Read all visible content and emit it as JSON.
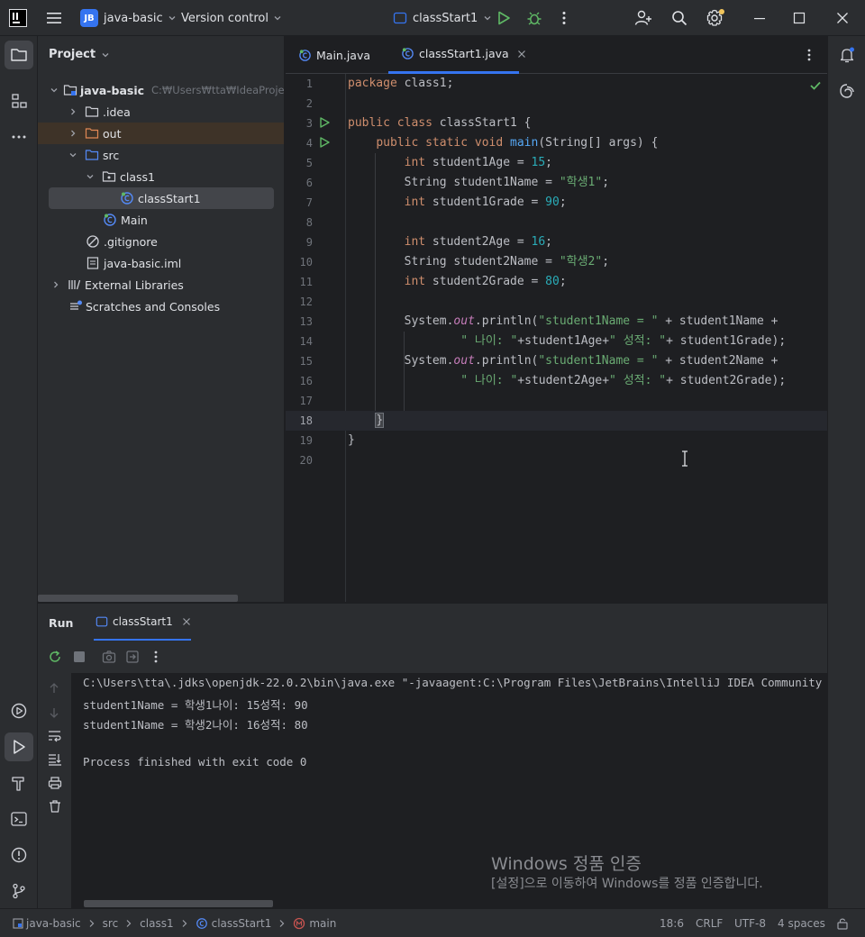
{
  "titlebar": {
    "project_badge": "JB",
    "project_name": "java-basic",
    "vcs_label": "Version control",
    "run_config": "classStart1"
  },
  "project_panel": {
    "title": "Project",
    "root_name": "java-basic",
    "root_path": "C:₩Users₩tta₩IdeaProjects₩java-basic",
    "items": [
      {
        "label": ".idea"
      },
      {
        "label": "out"
      },
      {
        "label": "src"
      },
      {
        "label": "class1"
      },
      {
        "label": "classStart1"
      },
      {
        "label": "Main"
      },
      {
        "label": ".gitignore"
      },
      {
        "label": "java-basic.iml"
      },
      {
        "label": "External Libraries"
      },
      {
        "label": "Scratches and Consoles"
      }
    ]
  },
  "editor": {
    "tabs": [
      {
        "label": "Main.java"
      },
      {
        "label": "classStart1.java"
      }
    ],
    "line_numbers": [
      "1",
      "2",
      "3",
      "4",
      "5",
      "6",
      "7",
      "8",
      "9",
      "10",
      "11",
      "12",
      "13",
      "14",
      "15",
      "16",
      "17",
      "18",
      "19",
      "20"
    ],
    "current_line": 18,
    "code": {
      "l1_kw": "package",
      "l1_rest": " class1;",
      "l3_kw": "public class",
      "l3_rest": " classStart1 {",
      "l4_kw": "public static void",
      "l4_fn": "main",
      "l4_rest": "(String[] args) {",
      "l5_kw": "int",
      "l5_a": " student1Age = ",
      "l5_num": "15",
      "l5_b": ";",
      "l6_a": "String student1Name = ",
      "l6_str": "\"학생1\"",
      "l6_b": ";",
      "l7_kw": "int",
      "l7_a": " student1Grade = ",
      "l7_num": "90",
      "l7_b": ";",
      "l9_kw": "int",
      "l9_a": " student2Age = ",
      "l9_num": "16",
      "l9_b": ";",
      "l10_a": "String student2Name = ",
      "l10_str": "\"학생2\"",
      "l10_b": ";",
      "l11_kw": "int",
      "l11_a": " student2Grade = ",
      "l11_num": "80",
      "l11_b": ";",
      "l13_a": "System.",
      "l13_fld": "out",
      "l13_b": ".println(",
      "l13_str": "\"student1Name = \"",
      "l13_c": " + student1Name +",
      "l14_str1": "\" 나이: \"",
      "l14_a": "+student1Age+",
      "l14_str2": "\" 성적: \"",
      "l14_b": "+ student1Grade);",
      "l15_a": "System.",
      "l15_fld": "out",
      "l15_b": ".println(",
      "l15_str": "\"student1Name = \"",
      "l15_c": " + student2Name +",
      "l16_str1": "\" 나이: \"",
      "l16_a": "+student2Age+",
      "l16_str2": "\" 성적: \"",
      "l16_b": "+ student2Grade);",
      "l18": "}",
      "l19": "}"
    }
  },
  "run_panel": {
    "title": "Run",
    "tab_label": "classStart1",
    "output": [
      "C:\\Users\\tta\\.jdks\\openjdk-22.0.2\\bin\\java.exe \"-javaagent:C:\\Program Files\\JetBrains\\IntelliJ IDEA Community",
      "student1Name = 학생1나이: 15성적: 90",
      "student1Name = 학생2나이: 16성적: 80",
      "",
      "Process finished with exit code 0"
    ]
  },
  "watermark": {
    "line1": "Windows 정품 인증",
    "line2": "[설정]으로 이동하여 Windows를 정품 인증합니다."
  },
  "statusbar": {
    "breadcrumbs": [
      "java-basic",
      "src",
      "class1",
      "classStart1",
      "main"
    ],
    "position": "18:6",
    "line_sep": "CRLF",
    "encoding": "UTF-8",
    "indent": "4 spaces"
  },
  "colors": {
    "accent": "#3574f0",
    "run_green": "#5fb865",
    "keyword": "#cf8e6d",
    "string": "#6aab73",
    "number": "#2aacb8",
    "function": "#56a8f5"
  }
}
